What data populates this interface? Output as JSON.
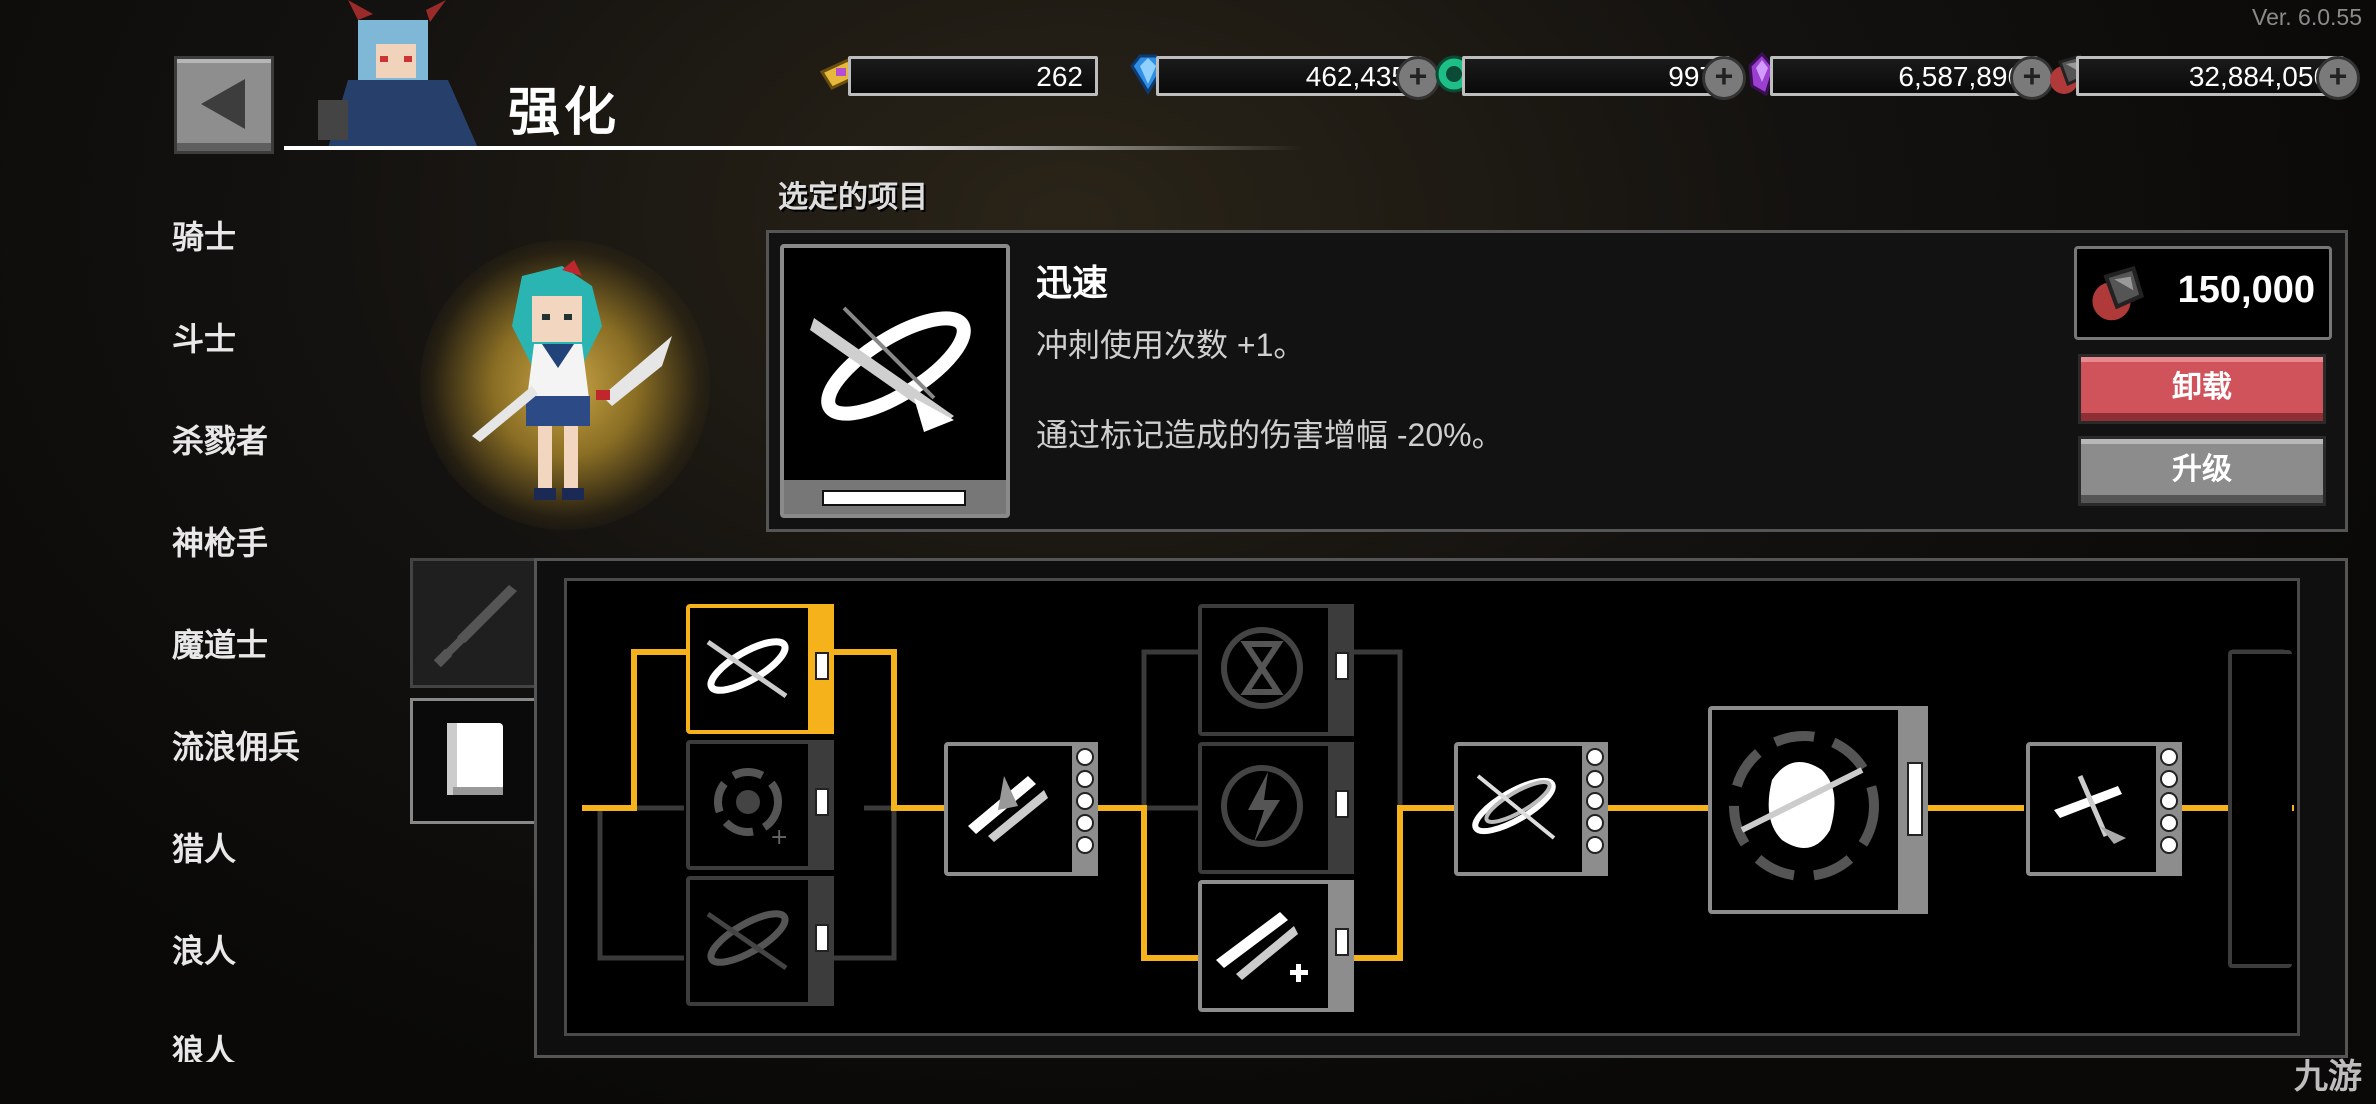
{
  "version": "Ver. 6.0.55",
  "header": {
    "title": "强化"
  },
  "resources": [
    {
      "icon": "ticket-icon",
      "value": "262",
      "has_plus": false,
      "color": "#e7b93a"
    },
    {
      "icon": "gem-icon",
      "value": "462,435",
      "has_plus": true,
      "color": "#2f8ee6"
    },
    {
      "icon": "orb-icon",
      "value": "997",
      "has_plus": true,
      "color": "#1dbf86"
    },
    {
      "icon": "crystal-icon",
      "value": "6,587,896",
      "has_plus": true,
      "color": "#9b3fd1"
    },
    {
      "icon": "ore-icon",
      "value": "32,884,056",
      "has_plus": true,
      "color": "#b03a3a"
    }
  ],
  "sidebar": {
    "items": [
      {
        "label": "骑士"
      },
      {
        "label": "斗士"
      },
      {
        "label": "杀戮者"
      },
      {
        "label": "神枪手"
      },
      {
        "label": "魔道士"
      },
      {
        "label": "流浪佣兵"
      },
      {
        "label": "猎人"
      },
      {
        "label": "浪人"
      },
      {
        "label": "狼人"
      }
    ]
  },
  "section_label": "选定的项目",
  "skill": {
    "name": "迅速",
    "desc1": "冲刺使用次数 +1。",
    "desc2": "通过标记造成的伤害增幅 -20%。",
    "cost": "150,000",
    "unload_label": "卸载",
    "upgrade_label": "升级"
  },
  "tabs": [
    {
      "icon": "sword-icon"
    },
    {
      "icon": "book-icon"
    }
  ],
  "watermark": "九游",
  "colors": {
    "accent": "#f6b21a",
    "danger": "#d0525b"
  }
}
